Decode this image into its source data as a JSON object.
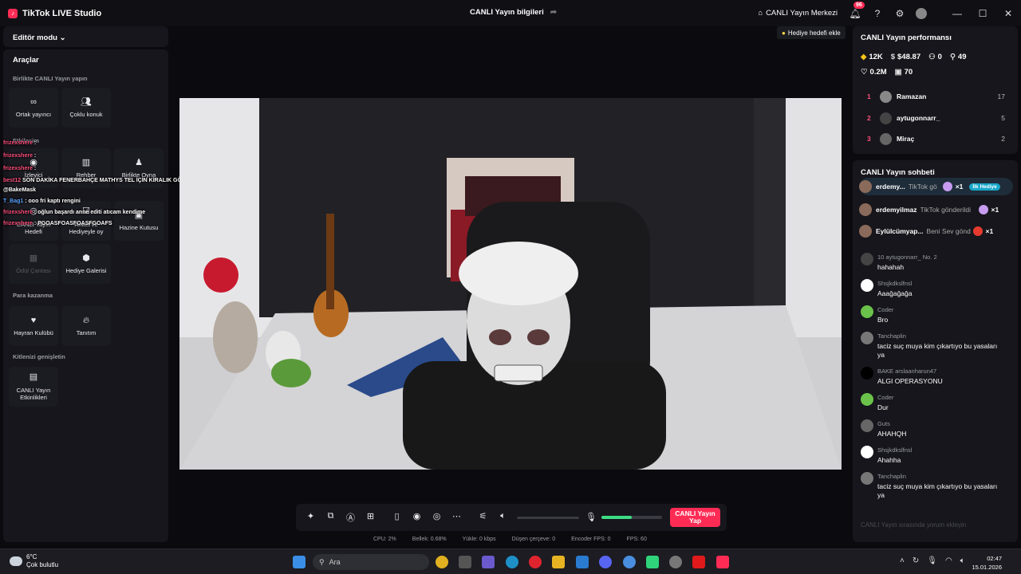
{
  "app": {
    "title": "TikTok LIVE Studio",
    "center_title": "CANLI Yayın bilgileri",
    "live_center": "CANLI Yayın Merkezi",
    "notif_count": "96"
  },
  "left": {
    "mode": "Editör modu",
    "tools_title": "Araçlar",
    "sec_together": "Birlikte CANLI Yayın yapın",
    "tool_cohost": "Ortak yayıncı",
    "tool_multi": "Çoklu konuk",
    "sec_interact": "Etkileşim",
    "tool_viewer": "İzleyici",
    "tool_guide": "Rehber",
    "tool_playtogether": "Birlikte Oyna",
    "tool_livegoal": "CANLI Yayın Hedefi",
    "tool_survey": "Anket ve Hediyeyle oy",
    "tool_treasure": "Hazine Kutusu",
    "tool_rewardbag": "Ödül Çantası",
    "tool_giftgallery": "Hediye Galerisi",
    "sec_earn": "Para kazanma",
    "tool_fanclub": "Hayran Kulübü",
    "tool_promo": "Tanıtım",
    "sec_expand": "Kitlenizi genişletin",
    "tool_events": "CANLI Yayın Etkinlikleri"
  },
  "overlay_chat": [
    {
      "name": "frizexshere",
      "text": ":"
    },
    {
      "name": "frizexshere",
      "text": ":"
    },
    {
      "name": "frizexshere",
      "text": ":"
    },
    {
      "name": "best12",
      "text": "SON DAKİKA FENERBAHÇE MATHYS TEL İÇİN KİRALIK GÖRÜŞMELERE BAŞLADI"
    },
    {
      "name": "",
      "text": "@BakeMask"
    },
    {
      "name": "T_Bag1",
      "text": ": ooo fri kaptı rengini"
    },
    {
      "name": "frizexshere",
      "text": ": oğlun başardı anne editi atıcam kendime"
    },
    {
      "name": "frizexshere",
      "text": ": PGOASFOASFOASFGOAFS"
    }
  ],
  "video": {
    "hint": "Hediye hedefi ekle"
  },
  "controls": {
    "go_live": "CANLI Yayın Yap",
    "mic_level": 0.5
  },
  "stats": {
    "cpu": "CPU:  2%",
    "memory": "Bellek:  0.68%",
    "upload": "Yükle:  0 kbps",
    "dropped": "Düşen çerçeve:  0",
    "encoder": "Encoder FPS:  0",
    "fps": "FPS:  60"
  },
  "right": {
    "perf_title": "CANLI Yayın performansı",
    "m1": "12K",
    "m2": "$48.87",
    "m3": "0",
    "m4": "49",
    "m5": "0.2M",
    "m6": "70",
    "ranking": [
      {
        "rank": "1",
        "name": "Ramazan",
        "value": "17"
      },
      {
        "rank": "2",
        "name": "aytugonnarr_",
        "value": "5"
      },
      {
        "rank": "3",
        "name": "Miraç",
        "value": "2"
      }
    ],
    "chat_title": "CANLI Yayın sohbeti",
    "gifts": [
      {
        "name": "erdemy...",
        "text": "TikTok gö",
        "count": "×1",
        "tag": "İlk Hediye"
      },
      {
        "name": "erdemyilmaz",
        "text": "TikTok gönderildi",
        "count": "×1",
        "tag": ""
      },
      {
        "name": "Eylülcümyap...",
        "text": "Beni Sev gönde",
        "count": "×1",
        "tag": ""
      }
    ],
    "messages": [
      {
        "name": "10  aytugonnarr_  No. 2",
        "text": "hahahah"
      },
      {
        "name": "Shsjkdkslfnsl",
        "text": "Aaağağağa"
      },
      {
        "name": "Coder",
        "text": "Bro"
      },
      {
        "name": "Tanchaplin",
        "text": "taciz suç muya kim çıkartıyo bu yasaları ya"
      },
      {
        "name": "BAKE  arslaanharun47",
        "text": "ALGI OPERASYONU"
      },
      {
        "name": "Coder",
        "text": "Dur"
      },
      {
        "name": "Guts",
        "text": "AHAHQH"
      },
      {
        "name": "Shsjkdkslfnsl",
        "text": "Ahahha"
      },
      {
        "name": "Tanchaplin",
        "text": "taciz suç muya kim çıkartıyo bu yasaları ya"
      }
    ],
    "input_placeholder": "CANLI Yayın sırasında yorum ekleyin"
  },
  "taskbar": {
    "temp": "6°C",
    "weather": "Çok bulutlu",
    "search": "Ara",
    "time": "02:47",
    "date": "15.01.2026"
  },
  "colors": {
    "accent": "#fe2c55",
    "panel": "#16161c",
    "bg": "#0b0b0f"
  }
}
